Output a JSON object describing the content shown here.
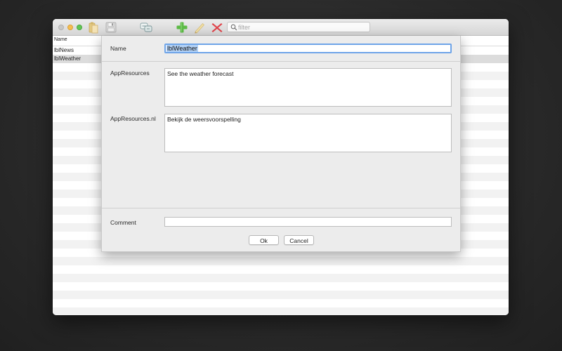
{
  "toolbar": {
    "filter_placeholder": "filter",
    "icons": [
      "paste-icon",
      "save-icon",
      "translate-icon",
      "add-icon",
      "edit-icon",
      "delete-icon",
      "search-icon"
    ]
  },
  "table": {
    "header": "Name",
    "rows": [
      "lblNews",
      "lblWeather"
    ],
    "selected_row": "lblWeather"
  },
  "dialog": {
    "name_label": "Name",
    "name_value": "lblWeather",
    "resource_label": "AppResources",
    "resource_value": "See the weather forecast",
    "resource_nl_label": "AppResources.nl",
    "resource_nl_value": "Bekijk de weersvoorspelling",
    "comment_label": "Comment",
    "comment_value": "",
    "ok_label": "Ok",
    "cancel_label": "Cancel"
  },
  "colors": {
    "focus_ring": "#6ea4e8",
    "selection": "#b3d2f7",
    "add": "#5dbb46",
    "delete": "#e0434a"
  }
}
